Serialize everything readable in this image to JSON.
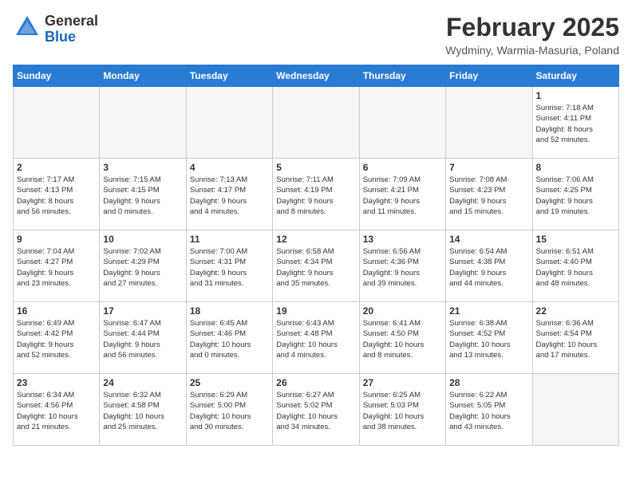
{
  "header": {
    "logo": {
      "general": "General",
      "blue": "Blue"
    },
    "title": "February 2025",
    "location": "Wydminy, Warmia-Masuria, Poland"
  },
  "weekdays": [
    "Sunday",
    "Monday",
    "Tuesday",
    "Wednesday",
    "Thursday",
    "Friday",
    "Saturday"
  ],
  "weeks": [
    [
      {
        "day": "",
        "info": ""
      },
      {
        "day": "",
        "info": ""
      },
      {
        "day": "",
        "info": ""
      },
      {
        "day": "",
        "info": ""
      },
      {
        "day": "",
        "info": ""
      },
      {
        "day": "",
        "info": ""
      },
      {
        "day": "1",
        "info": "Sunrise: 7:18 AM\nSunset: 4:11 PM\nDaylight: 8 hours\nand 52 minutes."
      }
    ],
    [
      {
        "day": "2",
        "info": "Sunrise: 7:17 AM\nSunset: 4:13 PM\nDaylight: 8 hours\nand 56 minutes."
      },
      {
        "day": "3",
        "info": "Sunrise: 7:15 AM\nSunset: 4:15 PM\nDaylight: 9 hours\nand 0 minutes."
      },
      {
        "day": "4",
        "info": "Sunrise: 7:13 AM\nSunset: 4:17 PM\nDaylight: 9 hours\nand 4 minutes."
      },
      {
        "day": "5",
        "info": "Sunrise: 7:11 AM\nSunset: 4:19 PM\nDaylight: 9 hours\nand 8 minutes."
      },
      {
        "day": "6",
        "info": "Sunrise: 7:09 AM\nSunset: 4:21 PM\nDaylight: 9 hours\nand 11 minutes."
      },
      {
        "day": "7",
        "info": "Sunrise: 7:08 AM\nSunset: 4:23 PM\nDaylight: 9 hours\nand 15 minutes."
      },
      {
        "day": "8",
        "info": "Sunrise: 7:06 AM\nSunset: 4:25 PM\nDaylight: 9 hours\nand 19 minutes."
      }
    ],
    [
      {
        "day": "9",
        "info": "Sunrise: 7:04 AM\nSunset: 4:27 PM\nDaylight: 9 hours\nand 23 minutes."
      },
      {
        "day": "10",
        "info": "Sunrise: 7:02 AM\nSunset: 4:29 PM\nDaylight: 9 hours\nand 27 minutes."
      },
      {
        "day": "11",
        "info": "Sunrise: 7:00 AM\nSunset: 4:31 PM\nDaylight: 9 hours\nand 31 minutes."
      },
      {
        "day": "12",
        "info": "Sunrise: 6:58 AM\nSunset: 4:34 PM\nDaylight: 9 hours\nand 35 minutes."
      },
      {
        "day": "13",
        "info": "Sunrise: 6:56 AM\nSunset: 4:36 PM\nDaylight: 9 hours\nand 39 minutes."
      },
      {
        "day": "14",
        "info": "Sunrise: 6:54 AM\nSunset: 4:38 PM\nDaylight: 9 hours\nand 44 minutes."
      },
      {
        "day": "15",
        "info": "Sunrise: 6:51 AM\nSunset: 4:40 PM\nDaylight: 9 hours\nand 48 minutes."
      }
    ],
    [
      {
        "day": "16",
        "info": "Sunrise: 6:49 AM\nSunset: 4:42 PM\nDaylight: 9 hours\nand 52 minutes."
      },
      {
        "day": "17",
        "info": "Sunrise: 6:47 AM\nSunset: 4:44 PM\nDaylight: 9 hours\nand 56 minutes."
      },
      {
        "day": "18",
        "info": "Sunrise: 6:45 AM\nSunset: 4:46 PM\nDaylight: 10 hours\nand 0 minutes."
      },
      {
        "day": "19",
        "info": "Sunrise: 6:43 AM\nSunset: 4:48 PM\nDaylight: 10 hours\nand 4 minutes."
      },
      {
        "day": "20",
        "info": "Sunrise: 6:41 AM\nSunset: 4:50 PM\nDaylight: 10 hours\nand 8 minutes."
      },
      {
        "day": "21",
        "info": "Sunrise: 6:38 AM\nSunset: 4:52 PM\nDaylight: 10 hours\nand 13 minutes."
      },
      {
        "day": "22",
        "info": "Sunrise: 6:36 AM\nSunset: 4:54 PM\nDaylight: 10 hours\nand 17 minutes."
      }
    ],
    [
      {
        "day": "23",
        "info": "Sunrise: 6:34 AM\nSunset: 4:56 PM\nDaylight: 10 hours\nand 21 minutes."
      },
      {
        "day": "24",
        "info": "Sunrise: 6:32 AM\nSunset: 4:58 PM\nDaylight: 10 hours\nand 25 minutes."
      },
      {
        "day": "25",
        "info": "Sunrise: 6:29 AM\nSunset: 5:00 PM\nDaylight: 10 hours\nand 30 minutes."
      },
      {
        "day": "26",
        "info": "Sunrise: 6:27 AM\nSunset: 5:02 PM\nDaylight: 10 hours\nand 34 minutes."
      },
      {
        "day": "27",
        "info": "Sunrise: 6:25 AM\nSunset: 5:03 PM\nDaylight: 10 hours\nand 38 minutes."
      },
      {
        "day": "28",
        "info": "Sunrise: 6:22 AM\nSunset: 5:05 PM\nDaylight: 10 hours\nand 43 minutes."
      },
      {
        "day": "",
        "info": ""
      }
    ]
  ]
}
